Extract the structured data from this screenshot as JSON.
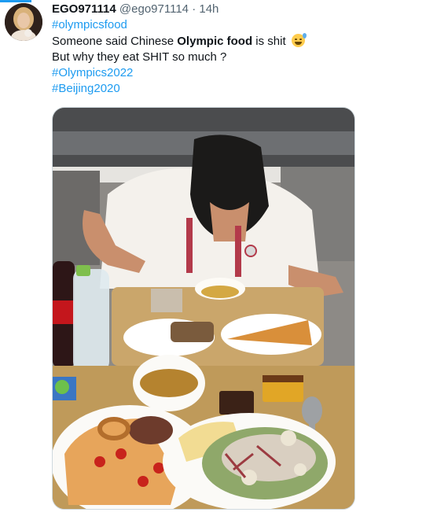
{
  "tweet": {
    "display_name": "EGO971114",
    "handle": "@ego971114",
    "separator": "·",
    "time": "14h",
    "hashtag_1": "#olympicsfood",
    "text_1_prefix": "Someone said Chinese ",
    "text_1_bold": "Olympic food",
    "text_1_suffix": " is shit",
    "emoji_1": "grinning-face-with-sweat",
    "text_2": "But why they eat SHIT so much ?",
    "hashtag_2": "#Olympics2022",
    "hashtag_3": "#Beijing2020"
  },
  "colors": {
    "accent": "#1d9bf0",
    "text": "#0f1419",
    "secondary_text": "#536471",
    "border": "#cfd9de"
  }
}
